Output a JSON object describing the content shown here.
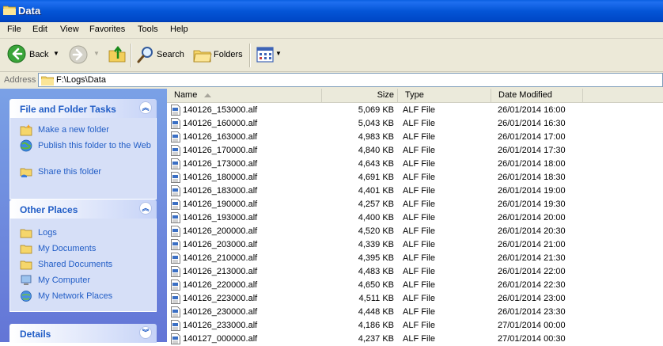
{
  "window": {
    "title": "Data"
  },
  "menu": [
    "File",
    "Edit",
    "View",
    "Favorites",
    "Tools",
    "Help"
  ],
  "toolbar": {
    "back": "Back",
    "search": "Search",
    "folders": "Folders"
  },
  "address": {
    "label": "Address",
    "path": "F:\\Logs\\Data"
  },
  "tasks_panel": {
    "title": "File and Folder Tasks",
    "items": [
      {
        "label": "Make a new folder",
        "icon": "new-folder-icon"
      },
      {
        "label": "Publish this folder to the Web",
        "icon": "publish-web-icon"
      },
      {
        "label": "Share this folder",
        "icon": "share-folder-icon"
      }
    ]
  },
  "places_panel": {
    "title": "Other Places",
    "items": [
      {
        "label": "Logs",
        "icon": "folder-icon"
      },
      {
        "label": "My Documents",
        "icon": "folder-icon"
      },
      {
        "label": "Shared Documents",
        "icon": "folder-icon"
      },
      {
        "label": "My Computer",
        "icon": "computer-icon"
      },
      {
        "label": "My Network Places",
        "icon": "network-icon"
      }
    ]
  },
  "details_panel": {
    "title": "Details"
  },
  "columns": {
    "name": "Name",
    "size": "Size",
    "type": "Type",
    "date": "Date Modified"
  },
  "files": [
    {
      "name": "140126_153000.alf",
      "size": "5,069 KB",
      "type": "ALF File",
      "date": "26/01/2014 16:00"
    },
    {
      "name": "140126_160000.alf",
      "size": "5,043 KB",
      "type": "ALF File",
      "date": "26/01/2014 16:30"
    },
    {
      "name": "140126_163000.alf",
      "size": "4,983 KB",
      "type": "ALF File",
      "date": "26/01/2014 17:00"
    },
    {
      "name": "140126_170000.alf",
      "size": "4,840 KB",
      "type": "ALF File",
      "date": "26/01/2014 17:30"
    },
    {
      "name": "140126_173000.alf",
      "size": "4,643 KB",
      "type": "ALF File",
      "date": "26/01/2014 18:00"
    },
    {
      "name": "140126_180000.alf",
      "size": "4,691 KB",
      "type": "ALF File",
      "date": "26/01/2014 18:30"
    },
    {
      "name": "140126_183000.alf",
      "size": "4,401 KB",
      "type": "ALF File",
      "date": "26/01/2014 19:00"
    },
    {
      "name": "140126_190000.alf",
      "size": "4,257 KB",
      "type": "ALF File",
      "date": "26/01/2014 19:30"
    },
    {
      "name": "140126_193000.alf",
      "size": "4,400 KB",
      "type": "ALF File",
      "date": "26/01/2014 20:00"
    },
    {
      "name": "140126_200000.alf",
      "size": "4,520 KB",
      "type": "ALF File",
      "date": "26/01/2014 20:30"
    },
    {
      "name": "140126_203000.alf",
      "size": "4,339 KB",
      "type": "ALF File",
      "date": "26/01/2014 21:00"
    },
    {
      "name": "140126_210000.alf",
      "size": "4,395 KB",
      "type": "ALF File",
      "date": "26/01/2014 21:30"
    },
    {
      "name": "140126_213000.alf",
      "size": "4,483 KB",
      "type": "ALF File",
      "date": "26/01/2014 22:00"
    },
    {
      "name": "140126_220000.alf",
      "size": "4,650 KB",
      "type": "ALF File",
      "date": "26/01/2014 22:30"
    },
    {
      "name": "140126_223000.alf",
      "size": "4,511 KB",
      "type": "ALF File",
      "date": "26/01/2014 23:00"
    },
    {
      "name": "140126_230000.alf",
      "size": "4,448 KB",
      "type": "ALF File",
      "date": "26/01/2014 23:30"
    },
    {
      "name": "140126_233000.alf",
      "size": "4,186 KB",
      "type": "ALF File",
      "date": "27/01/2014 00:00"
    },
    {
      "name": "140127_000000.alf",
      "size": "4,237 KB",
      "type": "ALF File",
      "date": "27/01/2014 00:30"
    }
  ]
}
